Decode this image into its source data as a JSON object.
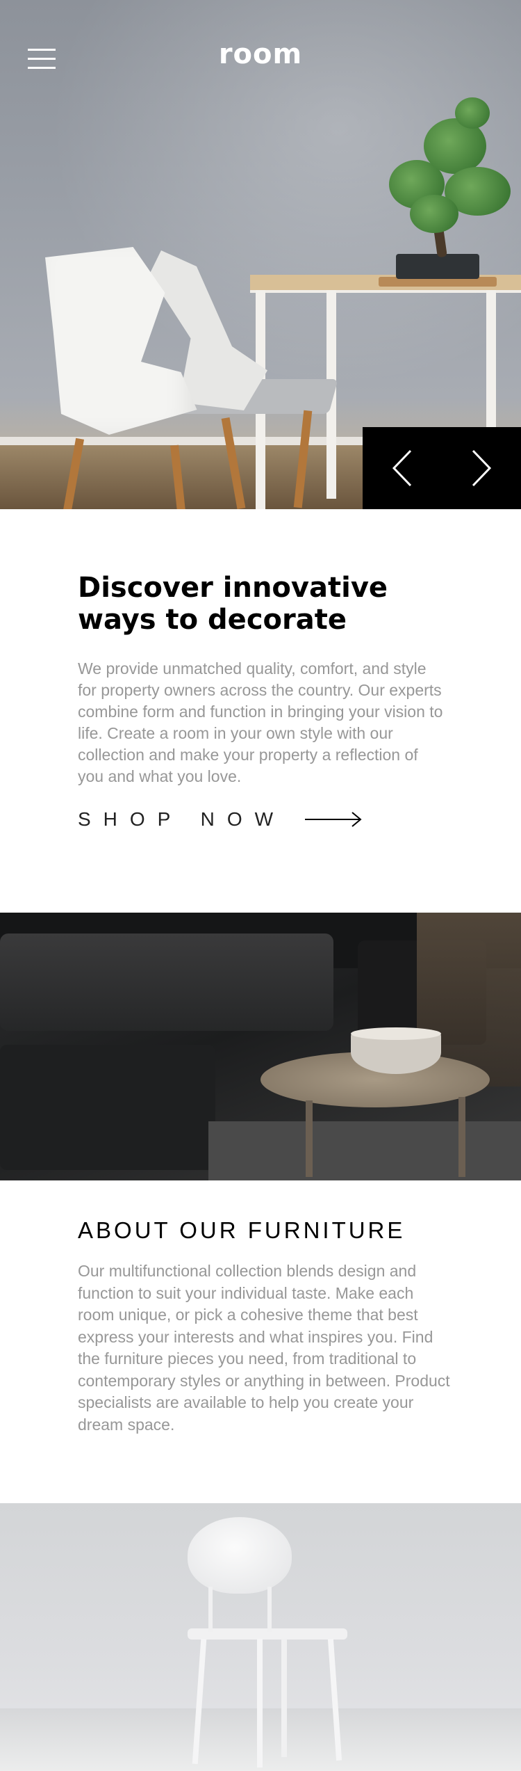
{
  "header": {
    "logo": "room",
    "menu_icon": "hamburger-menu-icon"
  },
  "hero": {
    "prev_icon": "chevron-left-icon",
    "next_icon": "chevron-right-icon"
  },
  "intro": {
    "title": "Discover innovative ways to decorate",
    "body": "We provide unmatched quality, comfort, and style for property owners across the country. Our experts combine form and function in bringing your vision to life. Create a room in your own style with our collection and make your property a reflection of you and what you love.",
    "cta_label": "SHOP NOW",
    "cta_icon": "arrow-right-icon"
  },
  "about": {
    "title": "ABOUT OUR FURNITURE",
    "body": "Our multifunctional collection blends design and function to suit your individual taste. Make each room unique, or pick a cohesive theme that best express your interests and what inspires you. Find the furniture pieces you need, from traditional to contemporary styles or anything in between. Product specialists are available to help you create your dream space."
  },
  "colors": {
    "accent": "#000000",
    "body_text": "#979797",
    "heading_text": "#000000",
    "background": "#ffffff"
  }
}
